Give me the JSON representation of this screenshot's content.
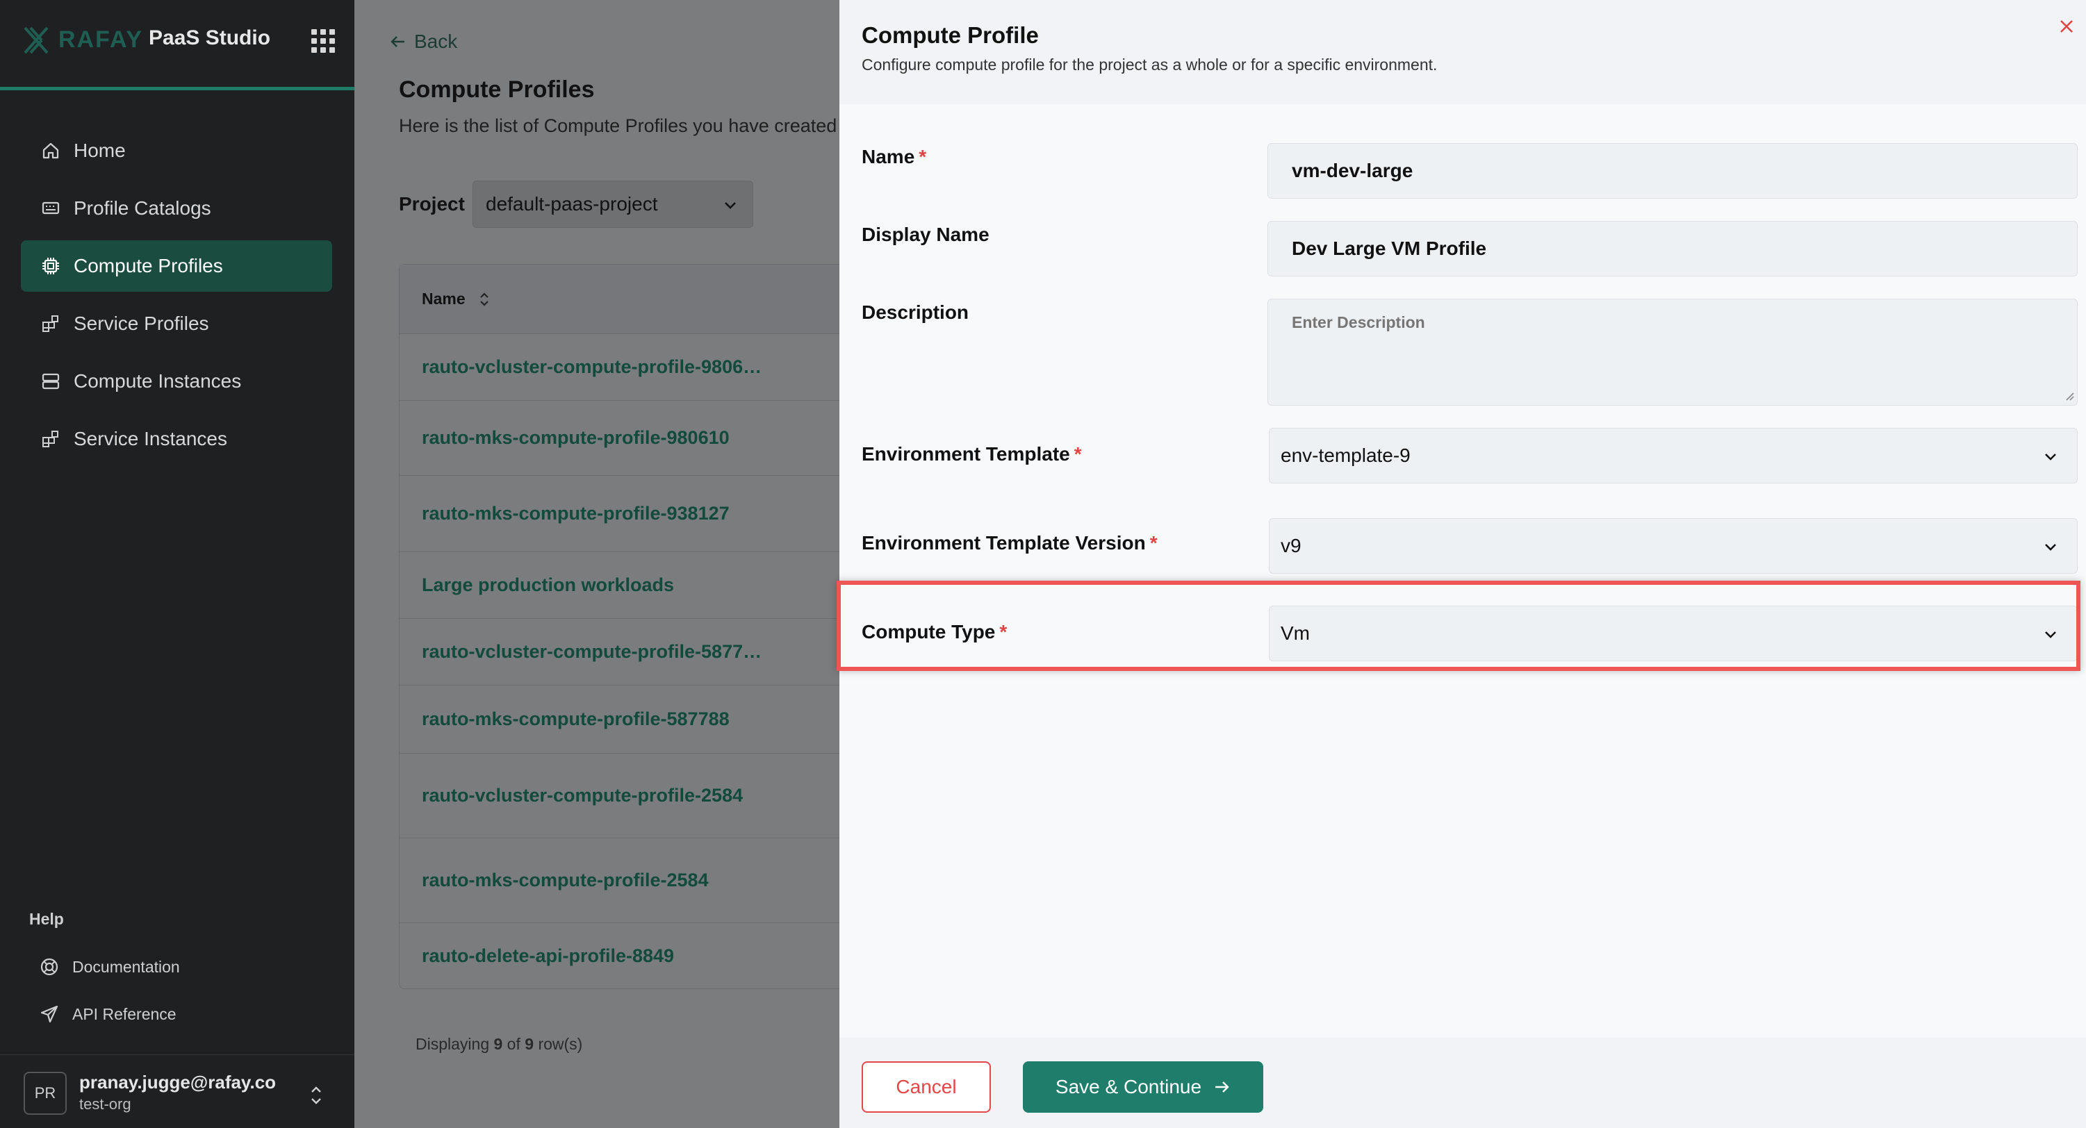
{
  "brand": {
    "wordmark": "RAFAY",
    "product": "PaaS Studio"
  },
  "sidebar": {
    "items": [
      {
        "label": "Home",
        "icon": "home-icon"
      },
      {
        "label": "Profile Catalogs",
        "icon": "catalog-icon"
      },
      {
        "label": "Compute Profiles",
        "icon": "chip-icon",
        "active": true
      },
      {
        "label": "Service Profiles",
        "icon": "blocks-icon"
      },
      {
        "label": "Compute Instances",
        "icon": "server-icon"
      },
      {
        "label": "Service Instances",
        "icon": "blocks-icon"
      }
    ],
    "help_title": "Help",
    "help_items": [
      {
        "label": "Documentation",
        "icon": "lifebuoy-icon"
      },
      {
        "label": "API Reference",
        "icon": "send-icon"
      }
    ]
  },
  "user": {
    "initials": "PR",
    "email": "pranay.jugge@rafay.co",
    "org": "test-org"
  },
  "main": {
    "back_label": "Back",
    "title": "Compute Profiles",
    "subtitle": "Here is the list of Compute Profiles you have created",
    "project_label": "Project",
    "project_value": "default-paas-project",
    "table_header": "Name",
    "rows": [
      "rauto-vcluster-compute-profile-9806…",
      "rauto-mks-compute-profile-980610",
      "rauto-mks-compute-profile-938127",
      "Large production workloads",
      "rauto-vcluster-compute-profile-5877…",
      "rauto-mks-compute-profile-587788",
      "rauto-vcluster-compute-profile-2584",
      "rauto-mks-compute-profile-2584",
      "rauto-delete-api-profile-8849"
    ],
    "footer": {
      "prefix": "Displaying ",
      "shown": "9",
      "mid": " of ",
      "total": "9",
      "suffix": " row(s)"
    }
  },
  "drawer": {
    "title": "Compute Profile",
    "subtitle": "Configure compute profile for the project as a whole or for a specific environment.",
    "fields": {
      "name_label": "Name",
      "name_value": "vm-dev-large",
      "display_label": "Display Name",
      "display_value": "Dev Large VM Profile",
      "desc_label": "Description",
      "desc_placeholder": "Enter Description",
      "env_label": "Environment Template",
      "env_value": "env-template-9",
      "ver_label": "Environment Template Version",
      "ver_value": "v9",
      "type_label": "Compute Type",
      "type_value": "Vm"
    },
    "required_mark": "*",
    "cancel_label": "Cancel",
    "save_label": "Save & Continue"
  },
  "colors": {
    "accent": "#1e7d6b",
    "danger": "#e24848",
    "sidebar_bg": "#1f2022",
    "highlight": "#ef5555"
  }
}
